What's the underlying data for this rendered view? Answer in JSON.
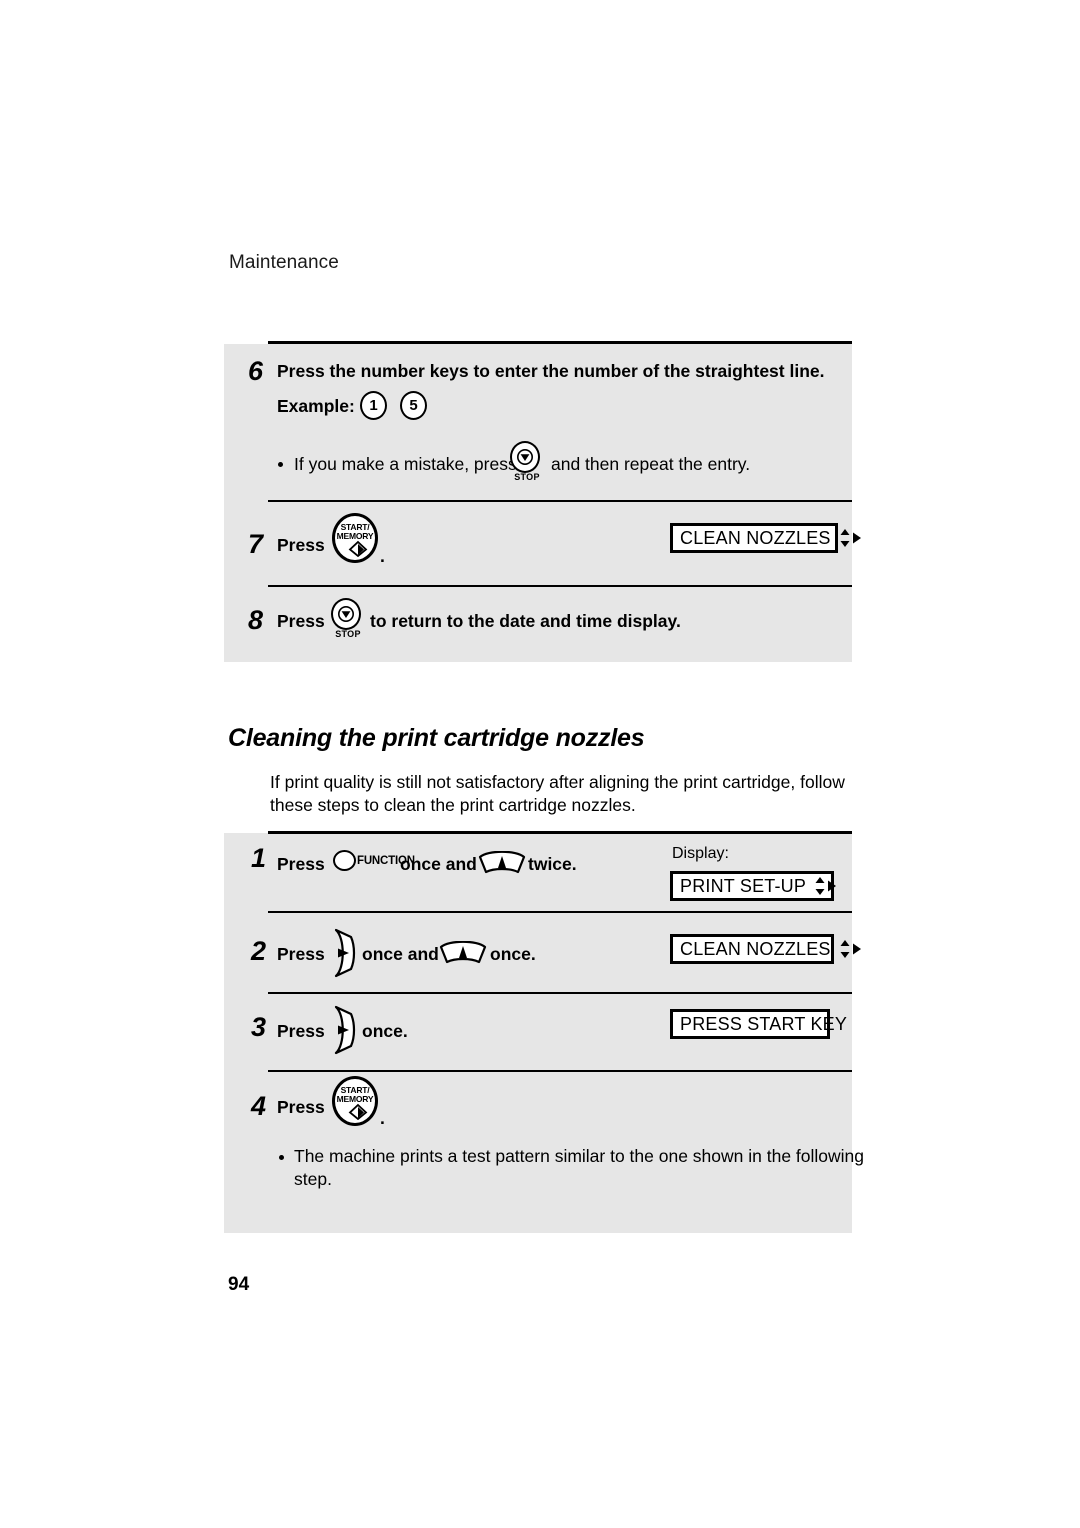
{
  "document": {
    "running_head": "Maintenance",
    "page_number": "94"
  },
  "section_heading": "Cleaning the print cartridge nozzles",
  "intro_paragraph": {
    "line1": "If print quality is still not satisfactory after aligning the print cartridge, follow",
    "line2": "these steps to clean the print cartridge nozzles."
  },
  "top_panel": {
    "steps": [
      {
        "number": "6",
        "text": "Press the number keys to enter the number of the straightest line.",
        "example_label": "Example:",
        "example_keys": [
          "1",
          "5"
        ],
        "bullet": {
          "before": "If you make a mistake, press",
          "icon": "stop-key",
          "after": "and then repeat the entry."
        }
      },
      {
        "number": "7",
        "press_label": "Press",
        "icon": "start-memory-key",
        "trailing": ".",
        "display": {
          "label": "CLEAN NOZZLES",
          "arrows": "up-down-right"
        }
      },
      {
        "number": "8",
        "press_label": "Press",
        "icon": "stop-key",
        "after": "to return to the date and time display."
      }
    ]
  },
  "bottom_panel": {
    "display_caption": "Display:",
    "steps": [
      {
        "number": "1",
        "press_label": "Press",
        "icon1": "function-key",
        "mid": "once and",
        "icon2": "up-arrow-key",
        "after": "twice.",
        "display": {
          "label": "PRINT SET-UP",
          "arrows": "up-down-right"
        }
      },
      {
        "number": "2",
        "press_label": "Press",
        "icon1": "right-arrow-key",
        "mid": "once and",
        "icon2": "up-arrow-key",
        "after": "once.",
        "display": {
          "label": "CLEAN NOZZLES",
          "arrows": "up-down-right"
        }
      },
      {
        "number": "3",
        "press_label": "Press",
        "icon1": "right-arrow-key",
        "after": "once.",
        "display": {
          "label": "PRESS START KEY",
          "arrows": "none"
        }
      },
      {
        "number": "4",
        "press_label": "Press",
        "icon1": "start-memory-key",
        "trailing": ".",
        "bullet": {
          "line1": "The machine prints a test pattern similar to the one shown in the following",
          "line2": "step."
        }
      }
    ]
  },
  "key_labels": {
    "function": "FUNCTION",
    "start_line1": "START/",
    "start_line2": "MEMORY",
    "stop": "STOP"
  },
  "colors": {
    "panel_background": "#e6e6e6",
    "page_background": "#ffffff",
    "ink": "#000000"
  }
}
